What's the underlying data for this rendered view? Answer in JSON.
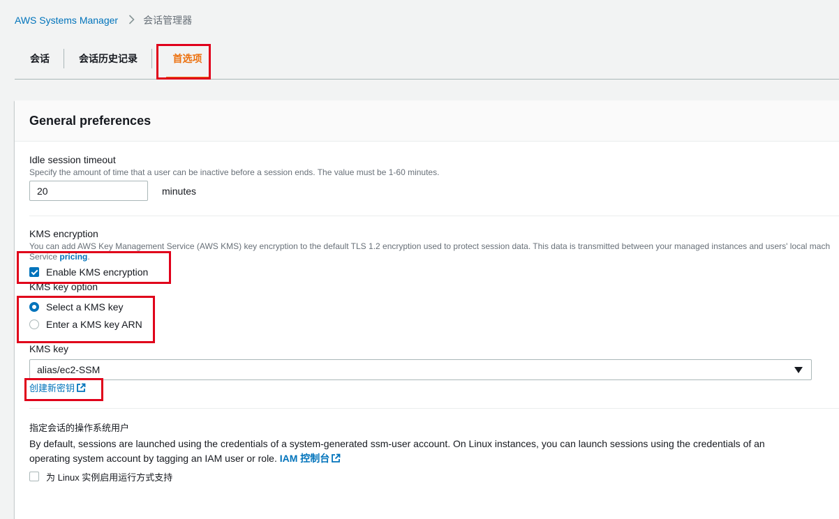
{
  "breadcrumb": {
    "service": "AWS Systems Manager",
    "current": "会话管理器"
  },
  "tabs": [
    {
      "label": "会话",
      "active": false
    },
    {
      "label": "会话历史记录",
      "active": false
    },
    {
      "label": "首选项",
      "active": true
    }
  ],
  "panel": {
    "title": "General preferences"
  },
  "idle_timeout": {
    "label": "Idle session timeout",
    "description": "Specify the amount of time that a user can be inactive before a session ends. The value must be 1-60 minutes.",
    "value": "20",
    "unit": "minutes"
  },
  "kms": {
    "label": "KMS encryption",
    "description": "You can add AWS Key Management Service (AWS KMS) key encryption to the default TLS 1.2 encryption used to protect session data. This data is transmitted between your managed instances and users' local mach",
    "description_line2": "Service",
    "pricing_link": "pricing",
    "description_end": ".",
    "enable_label": "Enable KMS encryption",
    "enable_checked": true,
    "key_option_label": "KMS key option",
    "options": [
      {
        "label": "Select a KMS key",
        "selected": true
      },
      {
        "label": "Enter a KMS key ARN",
        "selected": false
      }
    ],
    "key_label": "KMS key",
    "key_value": "alias/ec2-SSM",
    "create_key_link": "创建新密钥"
  },
  "os_user": {
    "label": "指定会话的操作系统用户",
    "line1": "By default, sessions are launched using the credentials of a system-generated ssm-user account. On Linux instances, you can launch sessions using the credentials of an",
    "line2": "operating system account by tagging an IAM user or role.",
    "iam_link": "IAM 控制台",
    "checkbox_label": "为 Linux 实例启用运行方式支持",
    "checkbox_checked": false
  },
  "colors": {
    "accent": "#ec7211",
    "link": "#0073bb",
    "highlight": "#e0001a",
    "page_bg": "#f2f3f3"
  },
  "icons": [
    "chevron-right-icon",
    "external-link-icon",
    "caret-down-icon"
  ]
}
